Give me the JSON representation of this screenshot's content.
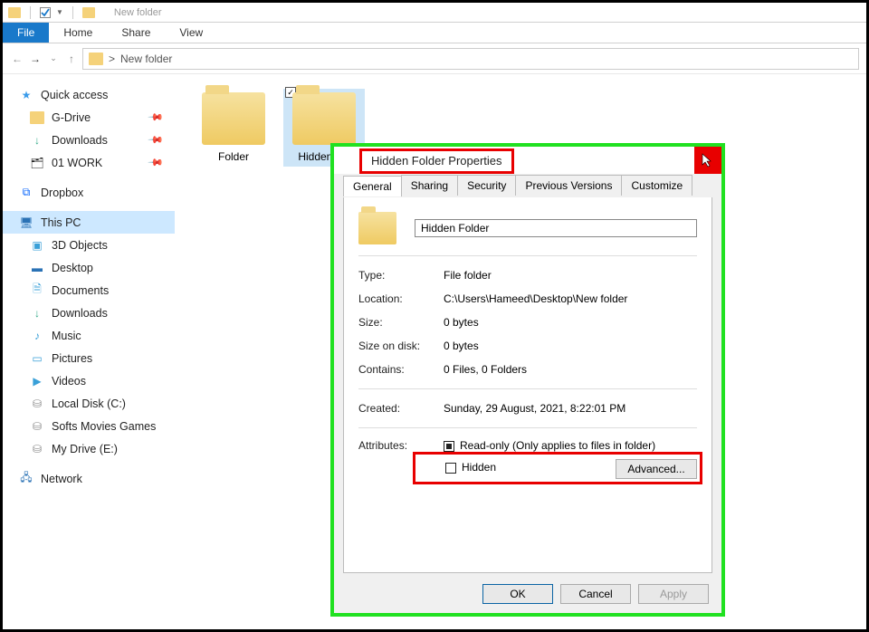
{
  "window": {
    "title": "New folder"
  },
  "ribbon": {
    "file": "File",
    "home": "Home",
    "share": "Share",
    "view": "View"
  },
  "breadcrumb": {
    "sep": ">",
    "current": "New folder"
  },
  "sidebar": {
    "quick": "Quick access",
    "gdrive": "G-Drive",
    "downloads_q": "Downloads",
    "work": "01 WORK",
    "dropbox": "Dropbox",
    "thispc": "This PC",
    "threed": "3D Objects",
    "desktop": "Desktop",
    "documents": "Documents",
    "downloads": "Downloads",
    "music": "Music",
    "pictures": "Pictures",
    "videos": "Videos",
    "disk_c": "Local Disk (C:)",
    "disk_d": "Softs Movies Games",
    "disk_e": "My Drive (E:)",
    "network": "Network"
  },
  "folders": {
    "a": "Folder",
    "b": "Hidden  F..."
  },
  "dialog": {
    "title": "Hidden Folder Properties",
    "tabs": {
      "general": "General",
      "sharing": "Sharing",
      "security": "Security",
      "prev": "Previous Versions",
      "custom": "Customize"
    },
    "name": "Hidden Folder",
    "type_l": "Type:",
    "type_v": "File folder",
    "loc_l": "Location:",
    "loc_v": "C:\\Users\\Hameed\\Desktop\\New folder",
    "size_l": "Size:",
    "size_v": "0 bytes",
    "sod_l": "Size on disk:",
    "sod_v": "0 bytes",
    "cont_l": "Contains:",
    "cont_v": "0 Files, 0 Folders",
    "created_l": "Created:",
    "created_v": "Sunday, 29 August, 2021, 8:22:01 PM",
    "attr_l": "Attributes:",
    "readonly": "Read-only (Only applies to files in folder)",
    "hidden": "Hidden",
    "advanced": "Advanced...",
    "ok": "OK",
    "cancel": "Cancel",
    "apply": "Apply"
  }
}
